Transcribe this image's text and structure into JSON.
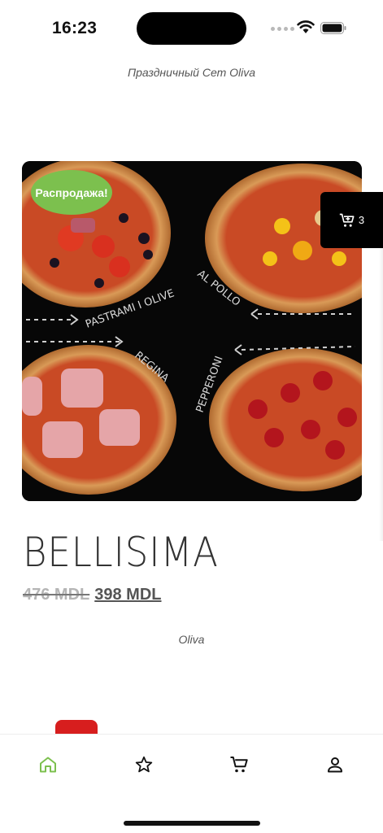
{
  "status_bar": {
    "time": "16:23"
  },
  "header": {
    "set_title": "Праздничный Сет Oliva"
  },
  "product": {
    "badge": "Распродажа!",
    "image_labels": [
      "PASTRAMI I OLIVE",
      "AL POLLO",
      "REGINA",
      "PEPPERONI"
    ],
    "name": "BELLISIMA",
    "old_price": "476 MDL",
    "new_price": "398 MDL",
    "brand": "Oliva"
  },
  "floating_cart": {
    "icon": "cart-add-icon",
    "count": "3"
  },
  "nav": {
    "active_color": "#7cc04e",
    "items": [
      {
        "icon": "home-icon",
        "active": true
      },
      {
        "icon": "star-icon",
        "active": false
      },
      {
        "icon": "cart-icon",
        "active": false
      },
      {
        "icon": "person-icon",
        "active": false
      }
    ]
  },
  "colors": {
    "sale_badge": "#7cc04e",
    "pizza_background": "#070707"
  }
}
